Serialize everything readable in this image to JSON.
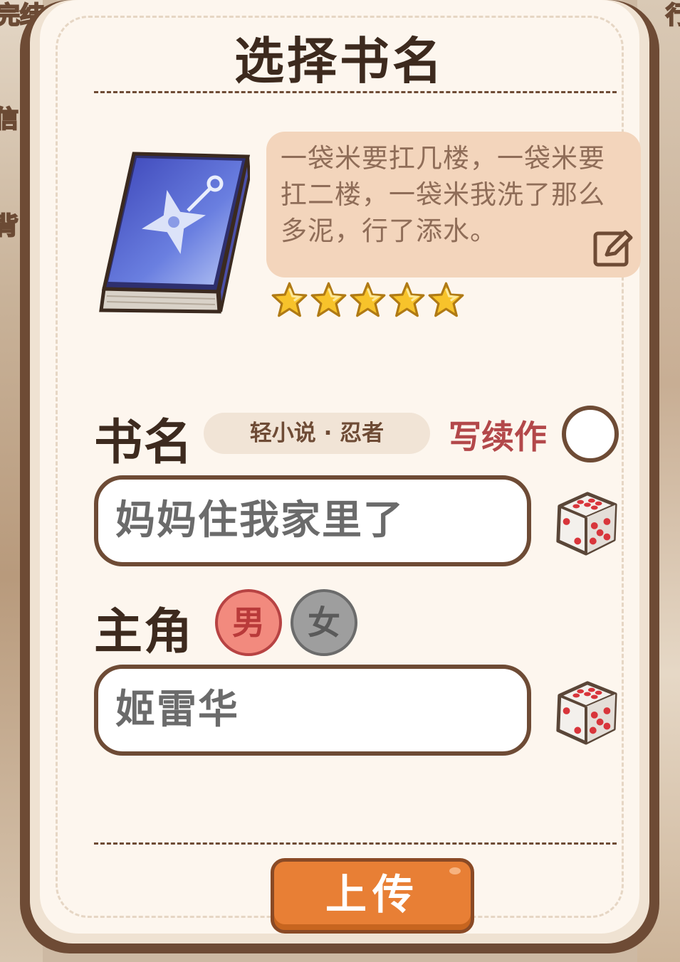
{
  "background": {
    "top_left_text": "完结",
    "top_right_text": "行",
    "left_side_texts": [
      "信",
      "背"
    ]
  },
  "dialog": {
    "title": "选择书名",
    "description": "一袋米要扛几楼，一袋米要扛二楼，一袋米我洗了那么多泥，行了添水。",
    "rating": 5,
    "book_name_label": "书名",
    "genre_tag": "轻小说 · 忍者",
    "sequel_label": "写续作",
    "sequel_checked": false,
    "book_name_value": "妈妈住我家里了",
    "protagonist_label": "主角",
    "gender_male": "男",
    "gender_female": "女",
    "selected_gender": "male",
    "protagonist_value": "姬雷华",
    "upload_label": "上传"
  },
  "colors": {
    "frame": "#6e4b35",
    "paper": "#fdf6ee",
    "desc_bg": "#f3d5bc",
    "accent_orange": "#e87f35",
    "sequel_red": "#b3484a"
  },
  "icons": {
    "book": "ninja-book-icon",
    "edit": "edit-icon",
    "star": "star-icon",
    "dice": "dice-icon"
  }
}
